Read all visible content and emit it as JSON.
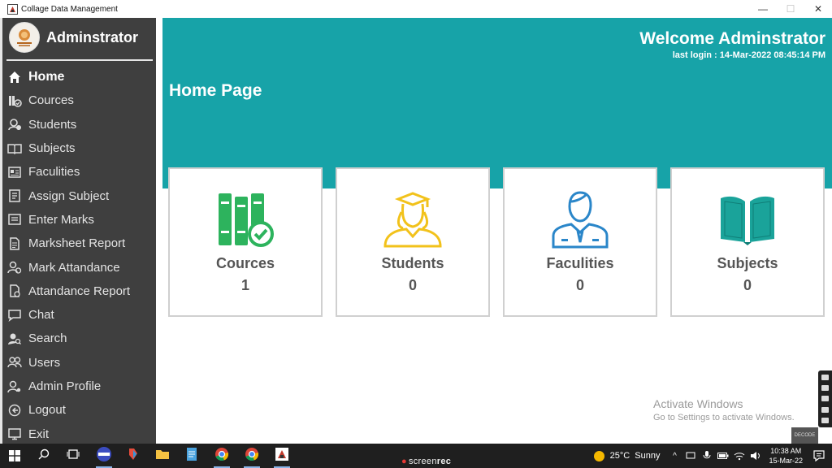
{
  "window": {
    "title": "Collage Data Management",
    "minimize_glyph": "—",
    "maximize_glyph": "☐",
    "close_glyph": "✕"
  },
  "sidebar": {
    "admin_name": "Adminstrator",
    "items": [
      {
        "label": "Home",
        "icon": "home-icon",
        "active": true
      },
      {
        "label": "Cources",
        "icon": "books-check-icon"
      },
      {
        "label": "Students",
        "icon": "students-icon"
      },
      {
        "label": "Subjects",
        "icon": "open-book-icon"
      },
      {
        "label": "Faculities",
        "icon": "id-card-icon"
      },
      {
        "label": "Assign Subject",
        "icon": "assign-icon"
      },
      {
        "label": "Enter Marks",
        "icon": "marks-icon"
      },
      {
        "label": "Marksheet Report",
        "icon": "report-icon"
      },
      {
        "label": "Mark Attandance",
        "icon": "attendance-icon"
      },
      {
        "label": "Attandance Report",
        "icon": "attendance-report-icon"
      },
      {
        "label": "Chat",
        "icon": "chat-icon"
      },
      {
        "label": "Search",
        "icon": "search-user-icon"
      },
      {
        "label": "Users",
        "icon": "users-icon"
      },
      {
        "label": "Admin Profile",
        "icon": "admin-profile-icon"
      },
      {
        "label": "Logout",
        "icon": "logout-icon"
      },
      {
        "label": "Exit",
        "icon": "exit-icon"
      }
    ]
  },
  "header": {
    "welcome": "Welcome Adminstrator",
    "last_login": "last login : 14-Mar-2022 08:45:14 PM",
    "page_title": "Home Page"
  },
  "cards": [
    {
      "label": "Cources",
      "count": "1",
      "icon": "books-check-icon",
      "color": "#2db35d"
    },
    {
      "label": "Students",
      "count": "0",
      "icon": "student-graduate-icon",
      "color": "#f2c21b"
    },
    {
      "label": "Faculities",
      "count": "0",
      "icon": "faculty-icon",
      "color": "#2a86c9"
    },
    {
      "label": "Subjects",
      "count": "0",
      "icon": "open-book-icon",
      "color": "#1aa39a"
    }
  ],
  "watermark": {
    "line1": "Activate Windows",
    "line2": "Go to Settings to activate Windows."
  },
  "overlay": {
    "decode": "DECODE",
    "screenrec_a": "screen",
    "screenrec_b": "rec"
  },
  "taskbar": {
    "weather_temp": "25°C",
    "weather_desc": "Sunny",
    "time": "10:38 AM",
    "date": "15-Mar-22"
  },
  "colors": {
    "banner": "#17a3a8",
    "sidebar": "#3f3f3f",
    "taskbar": "#1f1f1f"
  }
}
